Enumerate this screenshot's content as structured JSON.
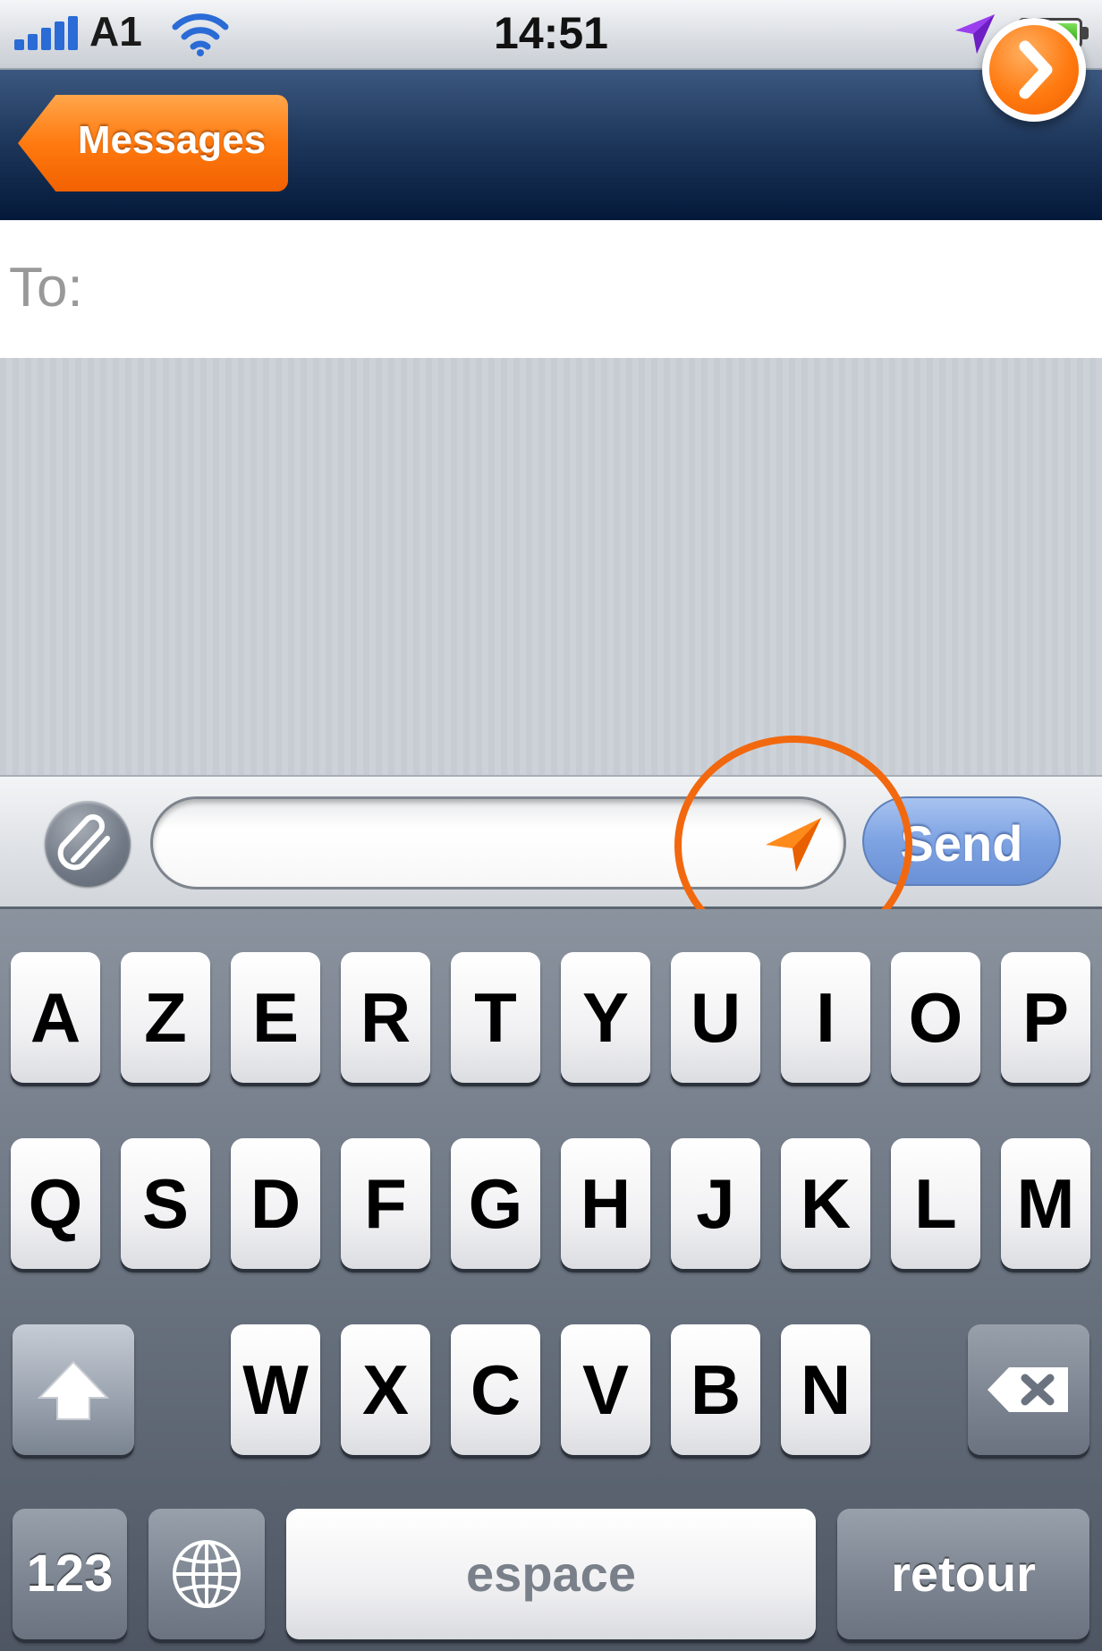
{
  "status_bar": {
    "carrier": "A1",
    "time": "14:51",
    "icons": [
      "signal-bars-icon",
      "wifi-icon",
      "location-arrow-icon",
      "battery-icon"
    ],
    "battery_level": 1.0
  },
  "nav_bar": {
    "back_label": "Messages"
  },
  "recipient": {
    "label": "To:",
    "add_icon": "chevron-right-icon"
  },
  "compose": {
    "message_value": "",
    "attach_icon": "paperclip-icon",
    "location_icon": "location-arrow-icon",
    "send_label": "Send"
  },
  "keyboard": {
    "row1": [
      "A",
      "Z",
      "E",
      "R",
      "T",
      "Y",
      "U",
      "I",
      "O",
      "P"
    ],
    "row2": [
      "Q",
      "S",
      "D",
      "F",
      "G",
      "H",
      "J",
      "K",
      "L",
      "M"
    ],
    "row3": [
      "W",
      "X",
      "C",
      "V",
      "B",
      "N"
    ],
    "numbers_label": "123",
    "space_label": "espace",
    "return_label": "retour",
    "shift_icon": "shift-arrow-icon",
    "backspace_icon": "backspace-icon",
    "globe_icon": "globe-icon"
  },
  "colors": {
    "accent_orange": "#ff7a10",
    "nav_dark_blue": "#04193a",
    "send_blue": "#7ea3e3",
    "highlight_orange": "#f2680f",
    "status_purple_arrow": "#9a3ff0"
  }
}
